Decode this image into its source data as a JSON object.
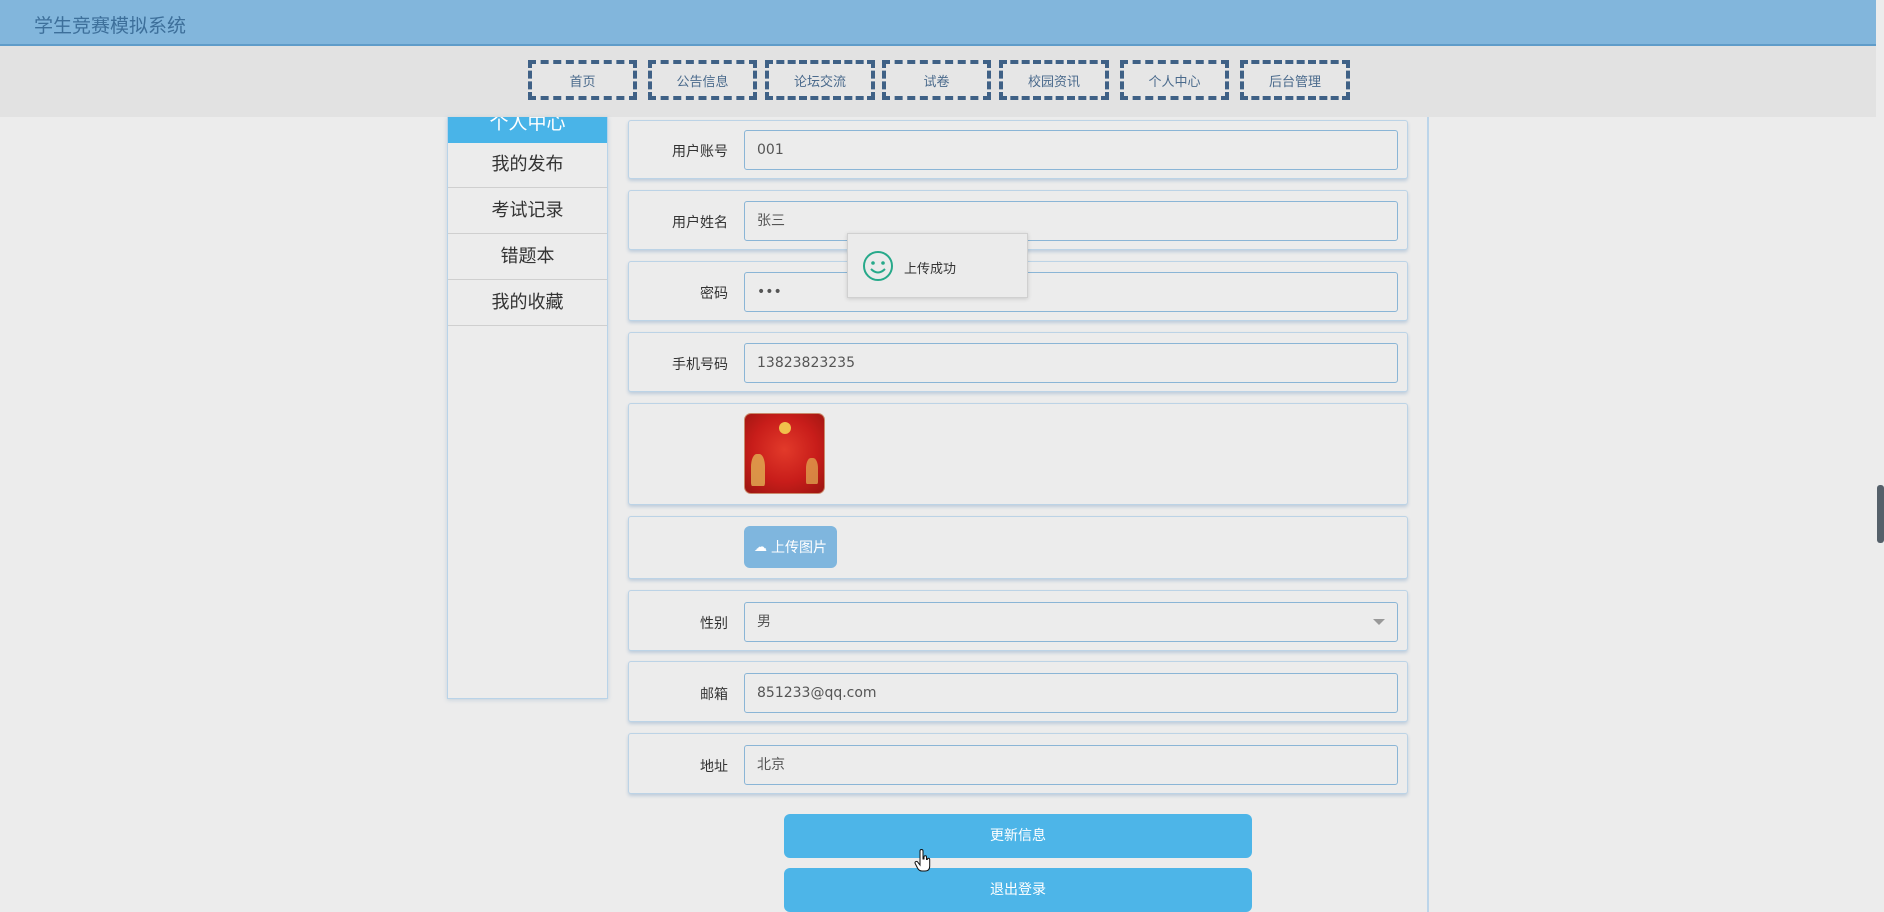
{
  "header": {
    "title": "学生竞赛模拟系统"
  },
  "nav": {
    "items": [
      {
        "label": "首页"
      },
      {
        "label": "公告信息"
      },
      {
        "label": "论坛交流"
      },
      {
        "label": "试卷"
      },
      {
        "label": "校园资讯"
      },
      {
        "label": "个人中心"
      },
      {
        "label": "后台管理"
      }
    ]
  },
  "sidebar": {
    "header": "个人中心",
    "items": [
      {
        "label": "我的发布"
      },
      {
        "label": "考试记录"
      },
      {
        "label": "错题本"
      },
      {
        "label": "我的收藏"
      }
    ]
  },
  "form": {
    "account": {
      "label": "用户账号",
      "value": "001"
    },
    "name": {
      "label": "用户姓名",
      "value": "张三"
    },
    "password": {
      "label": "密码",
      "value": "•••"
    },
    "phone": {
      "label": "手机号码",
      "value": "13823823235"
    },
    "upload_label": "上传图片",
    "gender": {
      "label": "性别",
      "value": "男"
    },
    "email": {
      "label": "邮箱",
      "value": "851233@qq.com"
    },
    "address": {
      "label": "地址",
      "value": "北京"
    }
  },
  "buttons": {
    "update": "更新信息",
    "logout": "退出登录"
  },
  "toast": {
    "message": "上传成功"
  },
  "colors": {
    "header_bg": "#82b6dc",
    "accent": "#4db5e8",
    "nav_border": "#3f6186",
    "toast_icon": "#27a98a"
  },
  "icons": {
    "toast": "smile-icon",
    "upload": "cloud-upload-icon",
    "select": "chevron-down-icon"
  }
}
